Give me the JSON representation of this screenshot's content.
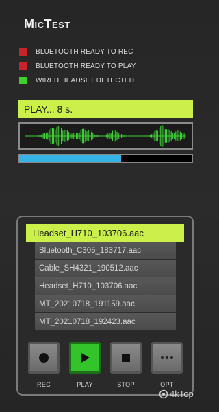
{
  "app": {
    "title": "MicTest"
  },
  "status": [
    {
      "label": "BLUETOOTH READY TO REC",
      "color": "#c8232a"
    },
    {
      "label": "BLUETOOTH READY TO PLAY",
      "color": "#c8232a"
    },
    {
      "label": "WIRED HEADSET DETECTED",
      "color": "#3fcf2a"
    }
  ],
  "player": {
    "status_text": "PLAY... 8 s.",
    "accent": "#ccf04a",
    "progress_fraction": 0.59,
    "progress_color": "#36b3e6",
    "wave_color": "#3ecf33"
  },
  "files": {
    "selected": "Headset_H710_103706.aac",
    "items": [
      "Bluetooth_C305_183717.aac",
      "Cable_SH4321_190512.aac",
      "Headset_H710_103706.aac",
      "MT_20210718_191159.aac",
      "MT_20210718_192423.aac"
    ]
  },
  "controls": [
    {
      "label": "REC",
      "icon": "record-icon",
      "active": false
    },
    {
      "label": "PLAY",
      "icon": "play-icon",
      "active": true
    },
    {
      "label": "STOP",
      "icon": "stop-icon",
      "active": false
    },
    {
      "label": "OPT",
      "icon": "more-icon",
      "active": false
    }
  ],
  "watermark": {
    "text": "4kTop"
  }
}
